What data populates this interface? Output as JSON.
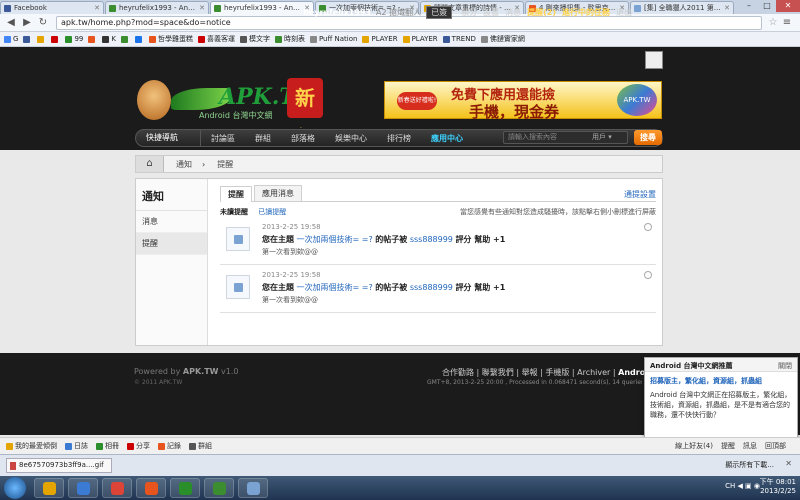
{
  "browser": {
    "tabs": [
      {
        "label": "Facebook",
        "color": "#3b5998"
      },
      {
        "label": "heyrufelix1993 - Andr...",
        "color": "#3c8d2f"
      },
      {
        "label": "heyrufelix1993 - Andr...",
        "color": "#3c8d2f",
        "active": true
      },
      {
        "label": "一次加兩個技術= =? -...",
        "color": "#3c8d2f"
      },
      {
        "label": "隨問文章重標的詩情 - 台...",
        "color": "#e4a500"
      },
      {
        "label": "4 剛來播訊集 - 歐思克...",
        "color": "#e8541e"
      },
      {
        "label": "[集] 全職獵人2011 第6...",
        "color": "#7aa3d4"
      }
    ],
    "url": "apk.tw/home.php?mod=space&do=notice",
    "bookmarks": [
      {
        "label": "G",
        "color": "#4285f4"
      },
      {
        "label": "",
        "color": "#3b5998"
      },
      {
        "label": "",
        "color": "#e4a500"
      },
      {
        "label": "",
        "color": "#cc0000"
      },
      {
        "label": "99",
        "color": "#2a8f2a"
      },
      {
        "label": "",
        "color": "#e8541e"
      },
      {
        "label": "K",
        "color": "#333333"
      },
      {
        "label": "",
        "color": "#3c8d2f"
      },
      {
        "label": "",
        "color": "#1a73e8"
      },
      {
        "label": "哲學雞蛋糕",
        "color": "#e8541e"
      },
      {
        "label": "喜義客運",
        "color": "#cc0000"
      },
      {
        "label": "模文字",
        "color": "#555555"
      },
      {
        "label": "時刻表",
        "color": "#3c8d2f"
      },
      {
        "label": "Puff Nation",
        "color": "#888888"
      },
      {
        "label": "PLAYER",
        "color": "#e4a500"
      },
      {
        "label": "PLAYER",
        "color": "#e4a500"
      },
      {
        "label": "TREND",
        "color": "#3b5998"
      },
      {
        "label": "佛鏈實家網",
        "color": "#888888"
      }
    ]
  },
  "site": {
    "username": "heyrufelix1993",
    "online_text": "A2 搶熾翻人",
    "signed": "已簽",
    "top_links": [
      "積分",
      "設置",
      "消息"
    ],
    "remind": "提醒(2)",
    "task": "進行中的任務",
    "logout": "退出",
    "logo_text": "APK.TW",
    "logo_sub": "Android 台灣中文網",
    "logo_cny": "新年",
    "ad": {
      "tag": "新春送好禮啦!",
      "line1": "免費下應用還能撿",
      "line2": "手機，現金券",
      "logo": "APK.TW"
    },
    "nav": {
      "quick": "快捷導航",
      "items": [
        "討論區",
        "群組",
        "部落格",
        "娛樂中心",
        "排行榜",
        "應用中心"
      ],
      "active_index": 5,
      "search_placeholder": "請輸入搜索內容",
      "search_type": "用戶",
      "search_btn": "搜尋"
    },
    "breadcrumb": [
      "通知",
      "提醒"
    ],
    "sidebar": {
      "title": "通知",
      "items": [
        "消息",
        "提醒"
      ],
      "selected": 1
    },
    "tabs": [
      "提醒",
      "應用消息"
    ],
    "remind_settings": "通提設置",
    "filter": {
      "unread": "未讀提醒",
      "read": "已讀提醒",
      "note": "當您感覺有些通知對您造成騷擾時，該點擊右側小刪標進行屏蔽"
    },
    "notices": [
      {
        "time": "2013-2-25 19:58",
        "prefix": "您在主題",
        "topic": "一次加兩個技術= =?",
        "mid": "的帖子被",
        "user": "sss888999",
        "suffix": "評分 幫助 +1",
        "quote": "第一次看到欸@@"
      },
      {
        "time": "2013-2-25 19:58",
        "prefix": "您在主題",
        "topic": "一次加兩個技術= =?",
        "mid": "的帖子被",
        "user": "sss888999",
        "suffix": "評分 幫助 +1",
        "quote": "第一次看到欸@@"
      }
    ]
  },
  "footer": {
    "powered": "Powered by",
    "powered_name": "APK.TW",
    "version": "v1.0",
    "copyright": "© 2011 APK.TW",
    "links": [
      "合作勸路",
      "聯繫我們",
      "舉報",
      "手機版",
      "Archiver"
    ],
    "brand": "Android 台",
    "gmt": "GMT+8, 2013-2-25 20:00 , Processed in 0.068471 second(s), 14 queries , Gzip On, Memc"
  },
  "toast": {
    "header": "Android 台灣中文網推薦",
    "close": "關閉",
    "title": "招募版主，繁化組，資源組，抓蟲組",
    "body": "Android 台灣中文網正在招募版主，繁化組，技術組，資源組，抓蟲組，是不是有適合您的職務，還不快快行動？"
  },
  "sitebar": {
    "items": [
      {
        "label": "我的最愛傾倒",
        "color": "#e4a500"
      },
      {
        "label": "日誌",
        "color": "#3b7bd3"
      },
      {
        "label": "相冊",
        "color": "#2a8f2a"
      },
      {
        "label": "分享",
        "color": "#cc0000"
      },
      {
        "label": "記錄",
        "color": "#e8541e"
      },
      {
        "label": "群組",
        "color": "#555555"
      }
    ],
    "right": [
      "線上好友(4)",
      "提醒",
      "訊息",
      "回頂部"
    ]
  },
  "download": {
    "file": "8e67570973b3ff9a....gif",
    "show_all": "顯示所有下載..."
  },
  "taskbar": {
    "apps": [
      {
        "color": "#e4a500"
      },
      {
        "color": "#3b7bd3"
      },
      {
        "color": "#db4437"
      },
      {
        "color": "#e8541e"
      },
      {
        "color": "#2a8f2a"
      },
      {
        "color": "#3c8d2f"
      },
      {
        "color": "#7aa3d4"
      }
    ],
    "tray": "CH ◀ ▣ ◉",
    "time": "下午 08:01",
    "date": "2013/2/25"
  }
}
